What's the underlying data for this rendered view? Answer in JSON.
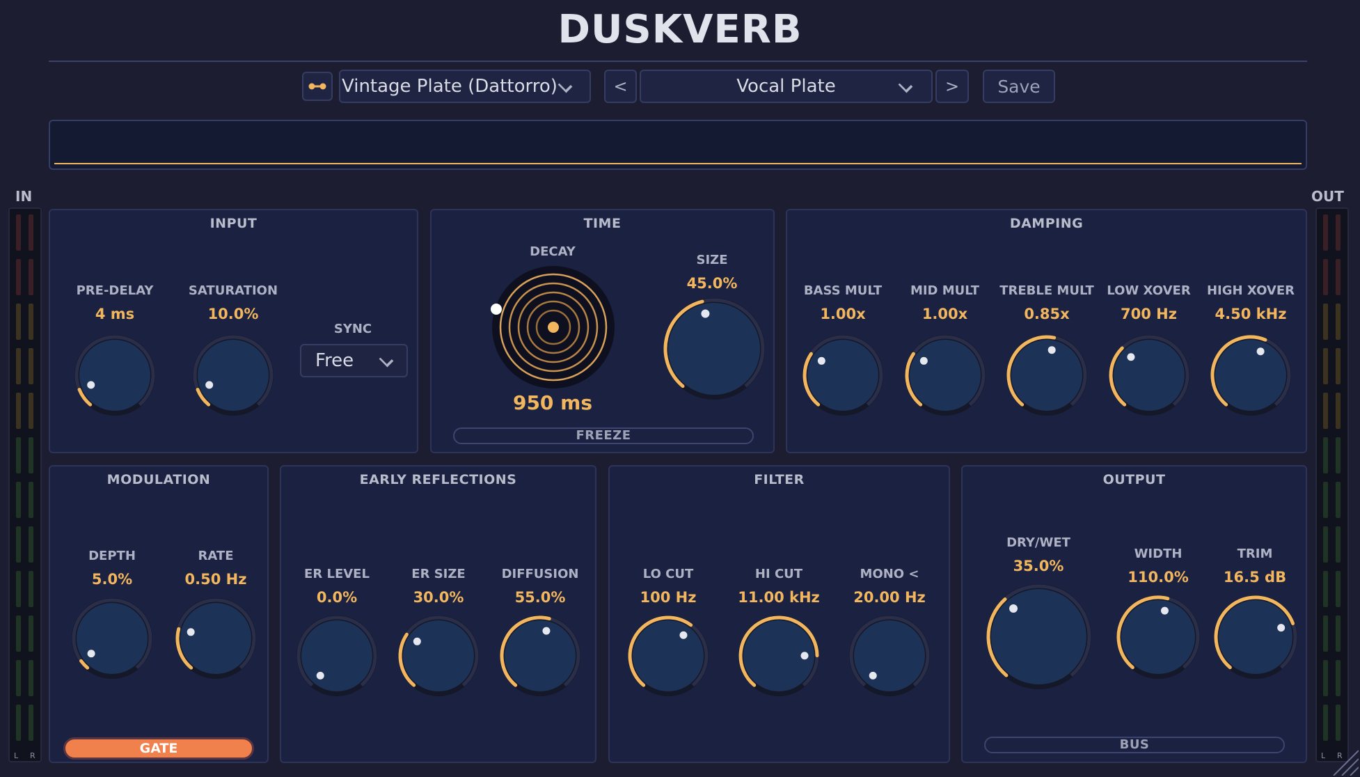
{
  "header": {
    "title": "DUSKVERB"
  },
  "toolbar": {
    "link_icon": "link-icon",
    "algorithm": "Vintage Plate (Dattorro)",
    "prev_label": "<",
    "preset": "Vocal Plate",
    "next_label": ">",
    "save_label": "Save"
  },
  "meters": {
    "in_label": "IN",
    "out_label": "OUT",
    "left": "L",
    "right": "R"
  },
  "input": {
    "title": "INPUT",
    "predelay": {
      "label": "PRE-DELAY",
      "value": "4 ms",
      "level": 0.1
    },
    "saturation": {
      "label": "SATURATION",
      "value": "10.0%",
      "level": 0.1
    },
    "sync": {
      "label": "SYNC",
      "value": "Free"
    }
  },
  "time": {
    "title": "TIME",
    "decay": {
      "label": "DECAY",
      "value": "950 ms"
    },
    "size": {
      "label": "SIZE",
      "value": "45.0%",
      "level": 0.45
    },
    "freeze_label": "FREEZE"
  },
  "damping": {
    "title": "DAMPING",
    "knobs": [
      {
        "label": "BASS MULT",
        "value": "1.00x",
        "level": 0.3
      },
      {
        "label": "MID MULT",
        "value": "1.00x",
        "level": 0.3
      },
      {
        "label": "TREBLE MULT",
        "value": "0.85x",
        "level": 0.54
      },
      {
        "label": "LOW XOVER",
        "value": "700 Hz",
        "level": 0.34
      },
      {
        "label": "HIGH XOVER",
        "value": "4.50 kHz",
        "level": 0.58
      }
    ]
  },
  "modulation": {
    "title": "MODULATION",
    "depth": {
      "label": "DEPTH",
      "value": "5.0%",
      "level": 0.05
    },
    "rate": {
      "label": "RATE",
      "value": "0.50 Hz",
      "level": 0.23
    },
    "gate_label": "GATE"
  },
  "early": {
    "title": "EARLY REFLECTIONS",
    "knobs": [
      {
        "label": "ER LEVEL",
        "value": "0.0%",
        "level": 0.0
      },
      {
        "label": "ER SIZE",
        "value": "30.0%",
        "level": 0.3
      },
      {
        "label": "DIFFUSION",
        "value": "55.0%",
        "level": 0.55
      }
    ]
  },
  "filter": {
    "title": "FILTER",
    "knobs": [
      {
        "label": "LO CUT",
        "value": "100 Hz",
        "level": 0.63
      },
      {
        "label": "HI CUT",
        "value": "11.00 kHz",
        "level": 0.82
      },
      {
        "label": "MONO <",
        "value": "20.00 Hz",
        "level": 0.0
      }
    ]
  },
  "output": {
    "title": "OUTPUT",
    "drywet": {
      "label": "DRY/WET",
      "value": "35.0%",
      "level": 0.35
    },
    "width": {
      "label": "WIDTH",
      "value": "110.0%",
      "level": 0.55
    },
    "trim": {
      "label": "TRIM",
      "value": "16.5 dB",
      "level": 0.75
    },
    "bus_label": "BUS"
  },
  "colors": {
    "accent": "#f2b65e",
    "gate": "#f0804c",
    "knob_body": "#1d3257",
    "track": "#2a2e48",
    "panel": "#1b2140"
  }
}
